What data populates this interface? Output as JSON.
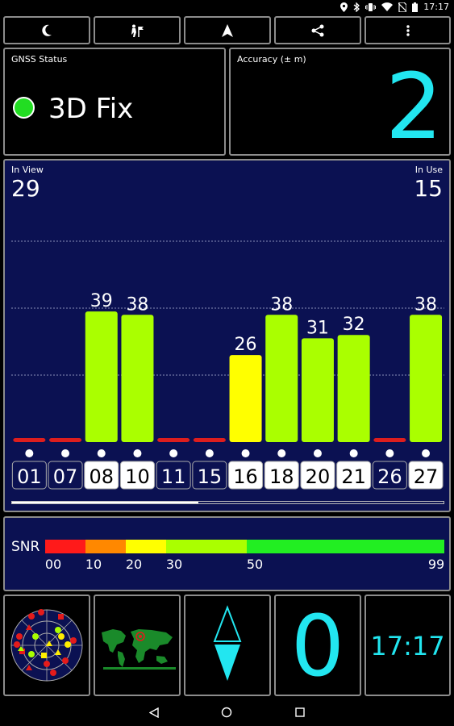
{
  "statusbar": {
    "time": "17:17",
    "icons": [
      "location-icon",
      "bluetooth-icon",
      "vibrate-icon",
      "wifi-icon",
      "no-sim-icon",
      "battery-icon"
    ]
  },
  "toolbar": {
    "buttons": [
      "night-mode-moon-icon",
      "place-marker-icon",
      "navigation-arrow-icon",
      "share-icon",
      "more-vert-icon"
    ]
  },
  "gnss": {
    "label": "GNSS Status",
    "status": "3D Fix",
    "status_color": "#22dd22"
  },
  "accuracy": {
    "label": "Accuracy (± m)",
    "value": "2",
    "color": "#22e6f0"
  },
  "satellites": {
    "in_view_label": "In View",
    "in_view": "29",
    "in_use_label": "In Use",
    "in_use": "15"
  },
  "chart_data": {
    "type": "bar",
    "categories": [
      "01",
      "07",
      "08",
      "10",
      "11",
      "15",
      "16",
      "18",
      "20",
      "21",
      "26",
      "27"
    ],
    "values": [
      1,
      1,
      39,
      38,
      1,
      1,
      26,
      38,
      31,
      32,
      1,
      38
    ],
    "labels": [
      "",
      "",
      "39",
      "38",
      "",
      "",
      "26",
      "38",
      "31",
      "32",
      "",
      "38"
    ],
    "in_use": [
      false,
      false,
      true,
      true,
      false,
      false,
      true,
      true,
      true,
      true,
      false,
      true
    ],
    "ylim": [
      0,
      50
    ],
    "grid": true,
    "colors": {
      "low": "#dd1e1e",
      "mid": "#ffff00",
      "high": "#aaff00"
    }
  },
  "scroll_progress": 0.43,
  "snr": {
    "label": "SNR",
    "scale_labels": [
      "00",
      "10",
      "20",
      "30",
      "50",
      "99"
    ],
    "segments": [
      {
        "from": 0,
        "to": 10,
        "color": "#ff1a1a"
      },
      {
        "from": 10,
        "to": 20,
        "color": "#ff8800"
      },
      {
        "from": 20,
        "to": 30,
        "color": "#ffff00"
      },
      {
        "from": 30,
        "to": 50,
        "color": "#aaff00"
      },
      {
        "from": 50,
        "to": 99,
        "color": "#22ee22"
      }
    ]
  },
  "tiles": {
    "compass_value": "0",
    "clock": "17:17",
    "accent": "#22e6f0"
  },
  "navbar": {
    "buttons": [
      "back-icon",
      "home-icon",
      "recents-icon"
    ]
  }
}
